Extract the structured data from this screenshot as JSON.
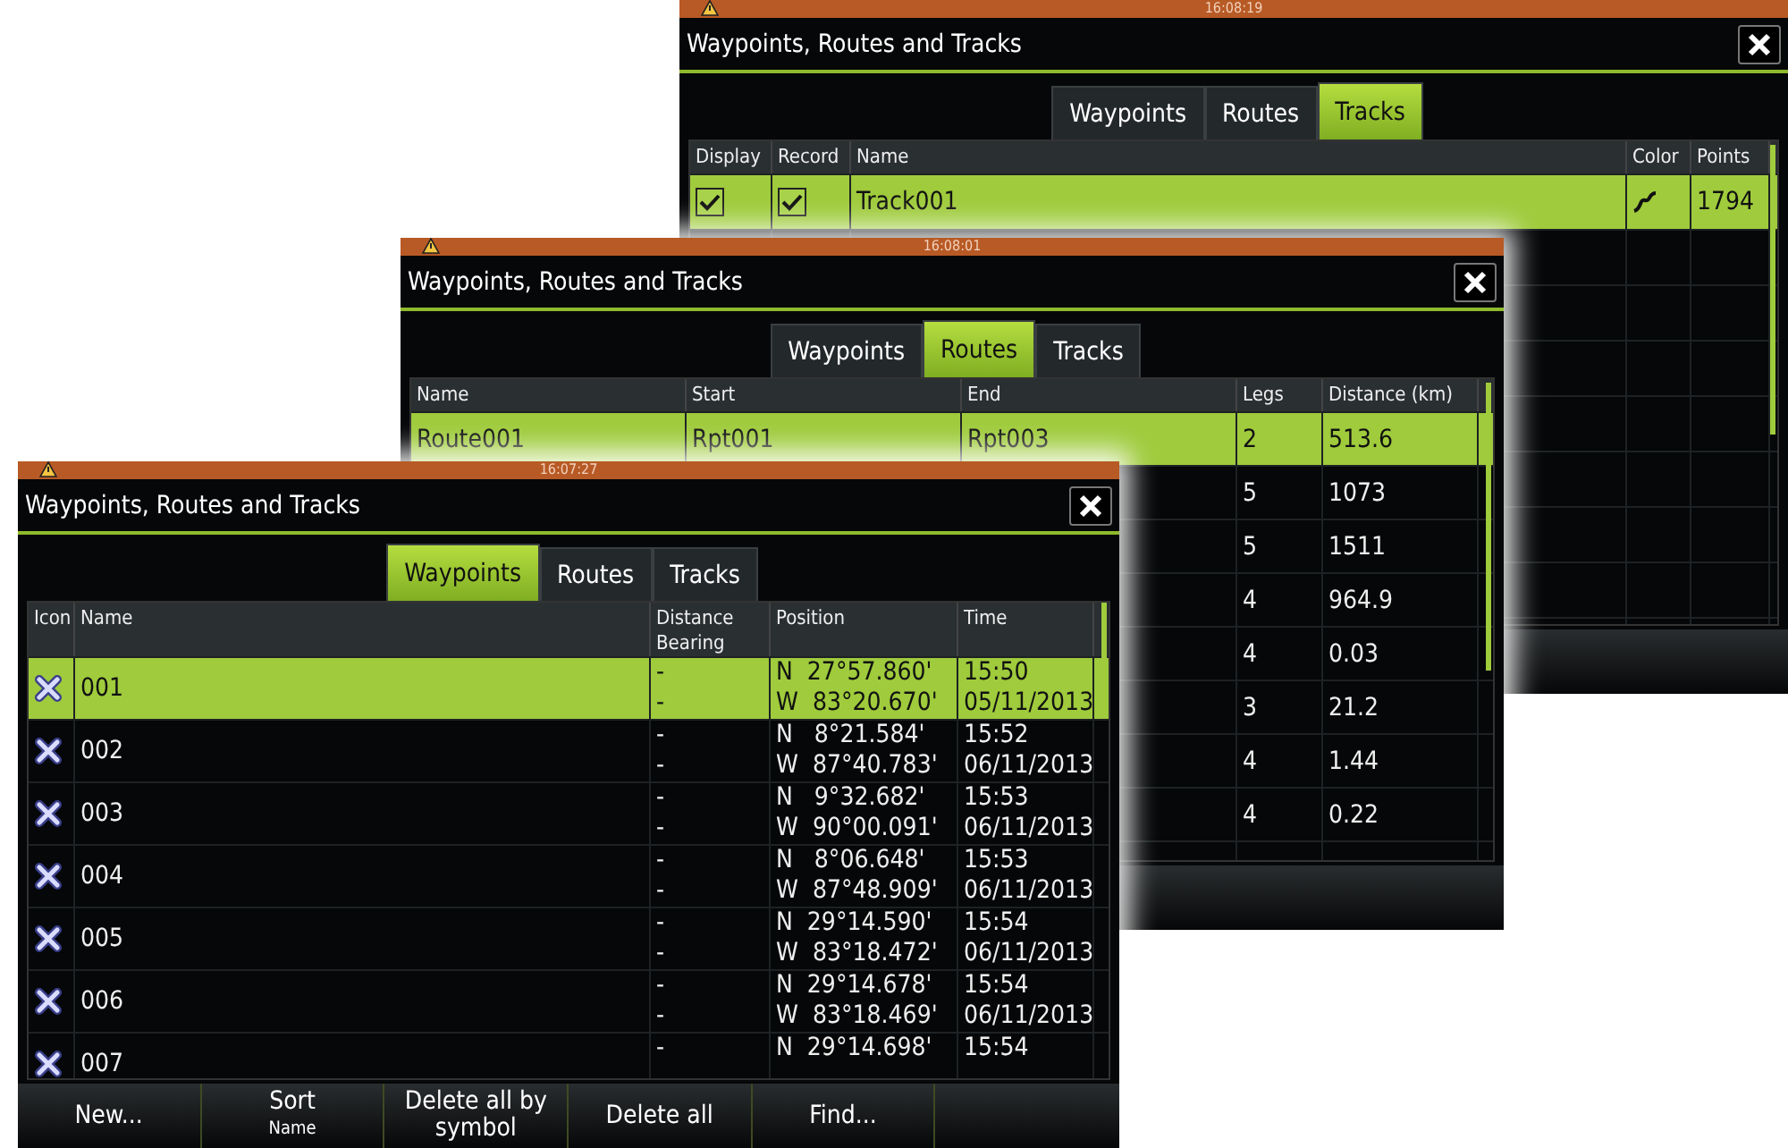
{
  "windows": [
    {
      "kind": "tracks",
      "status_time": "16:08:19",
      "title": "Waypoints, Routes and Tracks",
      "tabs": [
        {
          "label": "Waypoints",
          "selected": false
        },
        {
          "label": "Routes",
          "selected": false
        },
        {
          "label": "Tracks",
          "selected": true
        }
      ],
      "table": {
        "columns": [
          {
            "label": "Display",
            "kind": "check"
          },
          {
            "label": "Record",
            "kind": "check"
          },
          {
            "label": "Name",
            "kind": "text"
          },
          {
            "label": "Color",
            "kind": "swatch"
          },
          {
            "label": "Points",
            "kind": "text"
          }
        ],
        "rows": [
          {
            "selected": true,
            "cells": [
              {
                "checked": true
              },
              {
                "checked": true
              },
              "Track001",
              "",
              "1794"
            ]
          }
        ]
      }
    },
    {
      "kind": "routes",
      "status_time": "16:08:01",
      "title": "Waypoints, Routes and Tracks",
      "tabs": [
        {
          "label": "Waypoints",
          "selected": false
        },
        {
          "label": "Routes",
          "selected": true
        },
        {
          "label": "Tracks",
          "selected": false
        }
      ],
      "table": {
        "columns": [
          {
            "label": "Name",
            "kind": "text"
          },
          {
            "label": "Start",
            "kind": "text"
          },
          {
            "label": "End",
            "kind": "text"
          },
          {
            "label": "Legs",
            "kind": "text"
          },
          {
            "label": "Distance (km)",
            "kind": "text"
          }
        ],
        "rows": [
          {
            "selected": true,
            "cells": [
              "Route001",
              "Rpt001",
              "Rpt003",
              "2",
              "513.6"
            ]
          },
          {
            "selected": false,
            "cells": [
              null,
              null,
              null,
              "5",
              "1073"
            ]
          },
          {
            "selected": false,
            "cells": [
              null,
              null,
              null,
              "5",
              "1511"
            ]
          },
          {
            "selected": false,
            "cells": [
              null,
              null,
              null,
              "4",
              "964.9"
            ]
          },
          {
            "selected": false,
            "cells": [
              null,
              null,
              null,
              "4",
              "0.03"
            ]
          },
          {
            "selected": false,
            "cells": [
              null,
              null,
              null,
              "3",
              "21.2"
            ]
          },
          {
            "selected": false,
            "cells": [
              null,
              null,
              null,
              "4",
              "1.44"
            ]
          },
          {
            "selected": false,
            "cells": [
              null,
              null,
              null,
              "4",
              "0.22"
            ]
          }
        ]
      }
    },
    {
      "kind": "waypoints",
      "status_time": "16:07:27",
      "title": "Waypoints, Routes and Tracks",
      "tabs": [
        {
          "label": "Waypoints",
          "selected": true
        },
        {
          "label": "Routes",
          "selected": false
        },
        {
          "label": "Tracks",
          "selected": false
        }
      ],
      "table": {
        "columns": [
          {
            "label": "Icon",
            "kind": "icon"
          },
          {
            "label": "Name",
            "kind": "text"
          },
          {
            "label": "Distance Bearing",
            "kind": "lines"
          },
          {
            "label": "Position",
            "kind": "lines"
          },
          {
            "label": "Time",
            "kind": "lines"
          }
        ],
        "rows": [
          {
            "selected": true,
            "cells": [
              "",
              "001",
              [
                "-",
                "-"
              ],
              [
                "N  27°57.860'",
                "W  83°20.670'"
              ],
              [
                "15:50",
                "05/11/2013"
              ]
            ]
          },
          {
            "selected": false,
            "cells": [
              "",
              "002",
              [
                "-",
                "-"
              ],
              [
                "N   8°21.584'",
                "W  87°40.783'"
              ],
              [
                "15:52",
                "06/11/2013"
              ]
            ]
          },
          {
            "selected": false,
            "cells": [
              "",
              "003",
              [
                "-",
                "-"
              ],
              [
                "N   9°32.682'",
                "W  90°00.091'"
              ],
              [
                "15:53",
                "06/11/2013"
              ]
            ]
          },
          {
            "selected": false,
            "cells": [
              "",
              "004",
              [
                "-",
                "-"
              ],
              [
                "N   8°06.648'",
                "W  87°48.909'"
              ],
              [
                "15:53",
                "06/11/2013"
              ]
            ]
          },
          {
            "selected": false,
            "cells": [
              "",
              "005",
              [
                "-",
                "-"
              ],
              [
                "N  29°14.590'",
                "W  83°18.472'"
              ],
              [
                "15:54",
                "06/11/2013"
              ]
            ]
          },
          {
            "selected": false,
            "cells": [
              "",
              "006",
              [
                "-",
                "-"
              ],
              [
                "N  29°14.678'",
                "W  83°18.469'"
              ],
              [
                "15:54",
                "06/11/2013"
              ]
            ]
          },
          {
            "selected": false,
            "cells": [
              "",
              "007",
              [
                "-"
              ],
              [
                "N  29°14.698'"
              ],
              [
                "15:54"
              ]
            ]
          }
        ]
      },
      "buttons": [
        {
          "label": "New..."
        },
        {
          "label": "Sort",
          "value": "Name"
        },
        {
          "label": "Delete all by symbol"
        },
        {
          "label": "Delete all"
        },
        {
          "label": "Find..."
        }
      ]
    }
  ]
}
